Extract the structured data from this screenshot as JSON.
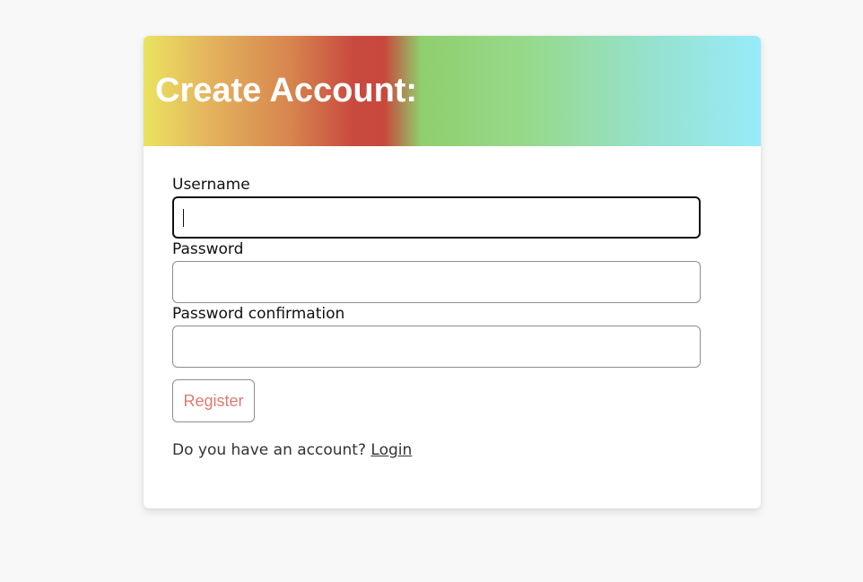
{
  "form": {
    "title": "Create Account:",
    "fields": [
      {
        "label": "Username",
        "value": "",
        "focused": true
      },
      {
        "label": "Password",
        "value": "",
        "focused": false
      },
      {
        "label": "Password confirmation",
        "value": "",
        "focused": false
      }
    ],
    "submit_label": "Register",
    "account_prompt": "Do you have an account?",
    "login_link": "Login"
  },
  "colors": {
    "page_background": "#f8f8f8",
    "card_background": "#ffffff",
    "title_text": "#ffffff",
    "register_text": "#e07a6f",
    "header_gradient": [
      "#ebe35f",
      "#e3b25d",
      "#d7844e",
      "#c84a3f",
      "#8fcf6e",
      "#96d98a",
      "#96e2d0",
      "#98ebf9"
    ]
  }
}
